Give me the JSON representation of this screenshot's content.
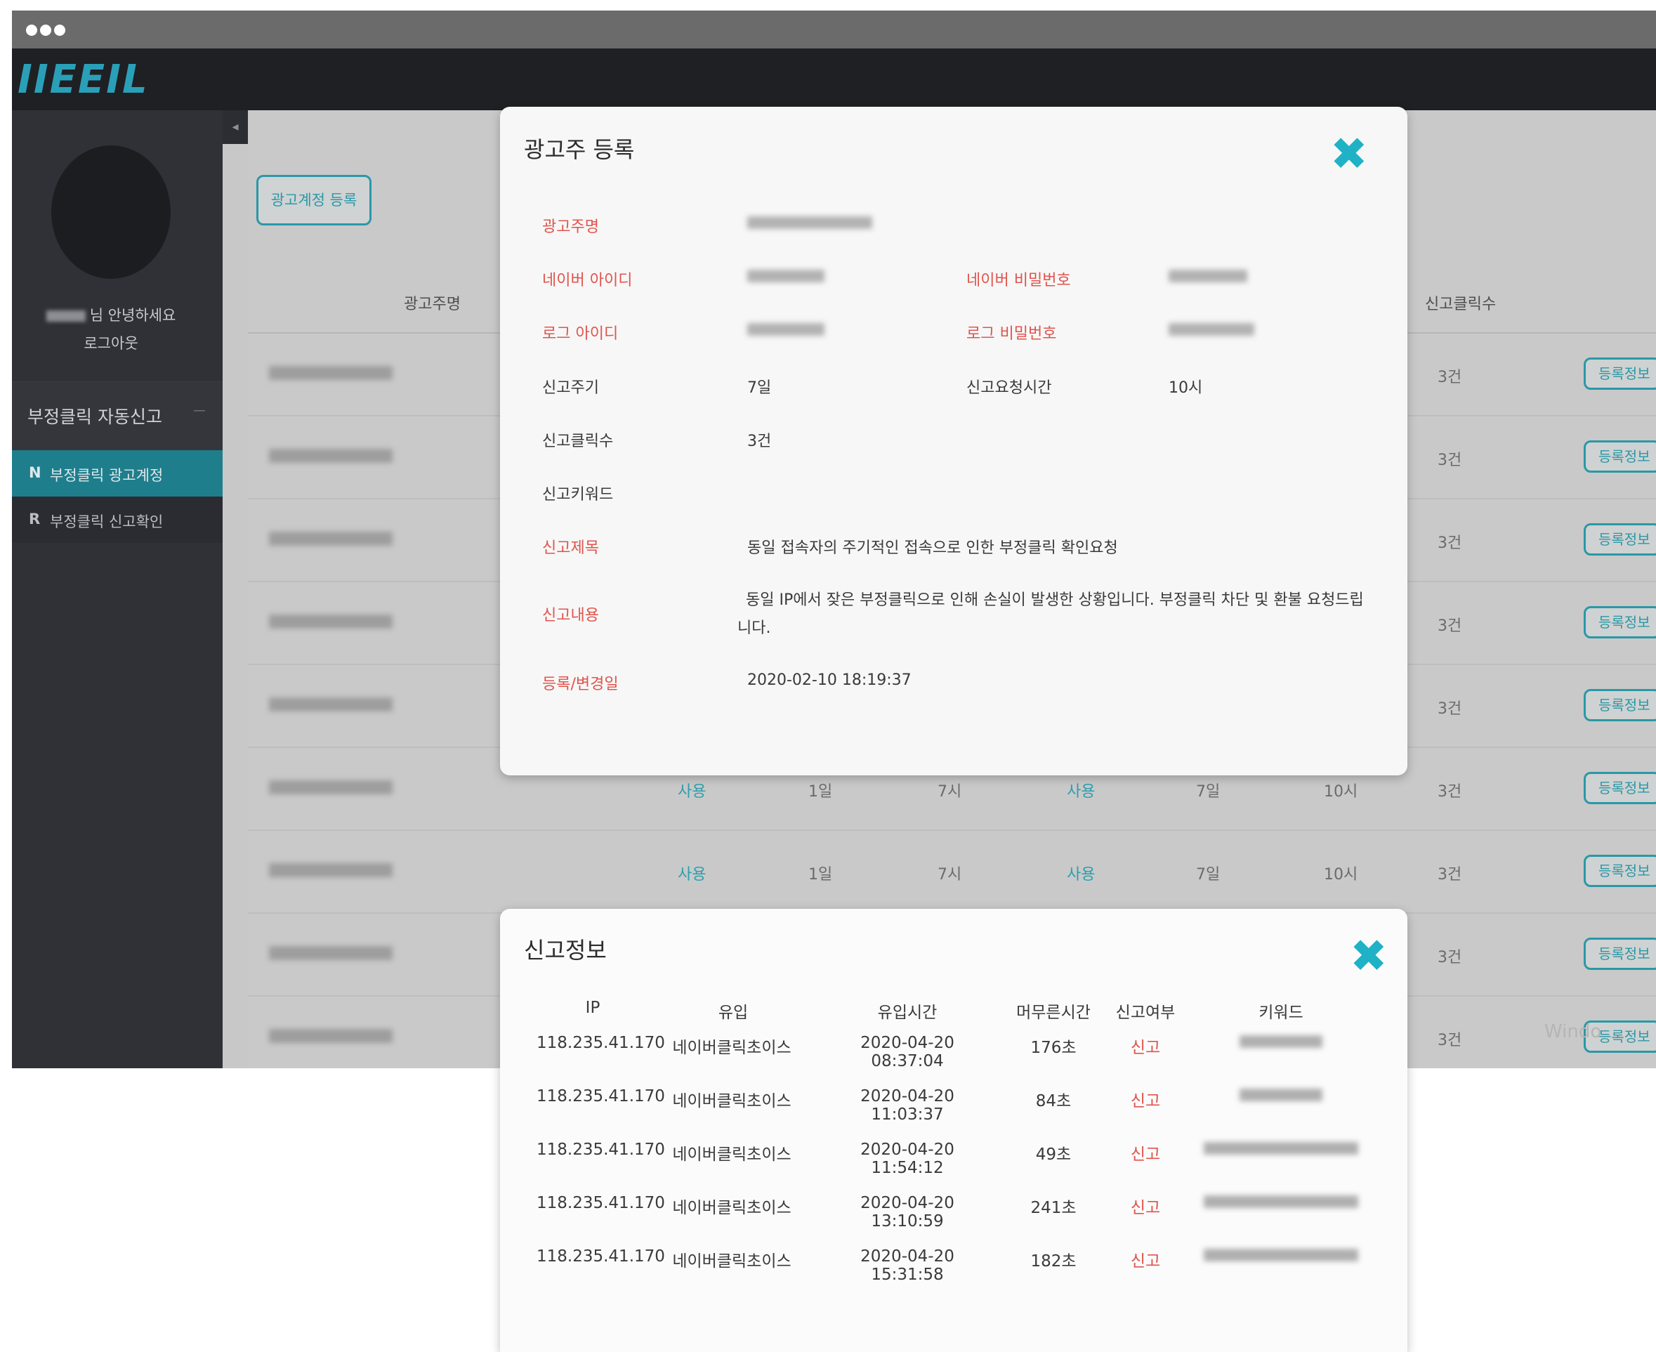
{
  "app": {
    "logo_text": "IIEEIL",
    "sidebar": {
      "greeting": "님 안녕하세요",
      "logout": "로그아웃",
      "menu_head": "부정클릭 자동신고",
      "menu_head_toggle": "－",
      "items": [
        {
          "letter": "N",
          "label": "부정클릭 광고계정"
        },
        {
          "letter": "R",
          "label": "부정클릭 신고확인"
        }
      ]
    },
    "content": {
      "register_button": "광고계정 등록",
      "table_headers": {
        "advertiser": "광고주명",
        "report_clicks": "신고클릭수"
      },
      "rows": [
        {
          "count": "3건",
          "button": "등록정보"
        },
        {
          "count": "3건",
          "button": "등록정보"
        },
        {
          "count": "3건",
          "button": "등록정보"
        },
        {
          "count": "3건",
          "button": "등록정보"
        },
        {
          "count": "3건",
          "button": "등록정보"
        },
        {
          "count": "3건",
          "button": "등록정보",
          "use1": "사용",
          "period": "1일",
          "hour": "7시",
          "use2": "사용",
          "cycle": "7일",
          "req": "10시"
        },
        {
          "count": "3건",
          "button": "등록정보",
          "use1": "사용",
          "period": "1일",
          "hour": "7시",
          "use2": "사용",
          "cycle": "7일",
          "req": "10시"
        },
        {
          "count": "3건",
          "button": "등록정보"
        },
        {
          "count": "3건",
          "button": "등록정보"
        }
      ],
      "watermark": "Windo"
    }
  },
  "advertiser_modal": {
    "title": "광고주 등록",
    "close": "✖",
    "labels": {
      "advertiser_name": "광고주명",
      "naver_id": "네이버 아이디",
      "naver_pw": "네이버 비밀번호",
      "log_id": "로그 아이디",
      "log_pw": "로그 비밀번호",
      "report_cycle": "신고주기",
      "report_time": "신고요청시간",
      "report_clicks": "신고클릭수",
      "report_keyword": "신고키워드",
      "report_subject": "신고제목",
      "report_content": "신고내용",
      "modified": "등록/변경일"
    },
    "values": {
      "report_cycle": "7일",
      "report_time": "10시",
      "report_clicks": "3건",
      "report_subject": "동일 접속자의 주기적인 접속으로 인한 부정클릭 확인요청",
      "report_content": "동일 IP에서 잦은 부정클릭으로 인해 손실이 발생한 상황입니다. 부정클릭 차단 및 환불 요청드립니다.",
      "modified": "2020-02-10 18:19:37"
    }
  },
  "report_modal": {
    "title": "신고정보",
    "close": "✖",
    "columns": [
      "IP",
      "유입",
      "유입시간",
      "머무른시간",
      "신고여부",
      "키워드"
    ],
    "rows": [
      {
        "ip": "118.235.41.170",
        "source": "네이버클릭초이스",
        "time": "2020-04-20 08:37:04",
        "stay": "176초",
        "reported": "신고"
      },
      {
        "ip": "118.235.41.170",
        "source": "네이버클릭초이스",
        "time": "2020-04-20 11:03:37",
        "stay": "84초",
        "reported": "신고"
      },
      {
        "ip": "118.235.41.170",
        "source": "네이버클릭초이스",
        "time": "2020-04-20 11:54:12",
        "stay": "49초",
        "reported": "신고"
      },
      {
        "ip": "118.235.41.170",
        "source": "네이버클릭초이스",
        "time": "2020-04-20 13:10:59",
        "stay": "241초",
        "reported": "신고"
      },
      {
        "ip": "118.235.41.170",
        "source": "네이버클릭초이스",
        "time": "2020-04-20 15:31:58",
        "stay": "182초",
        "reported": "신고"
      }
    ]
  },
  "colors": {
    "accent": "#1fb2c6",
    "label_red": "#e0544c",
    "active_menu": "#1f7e8c"
  }
}
